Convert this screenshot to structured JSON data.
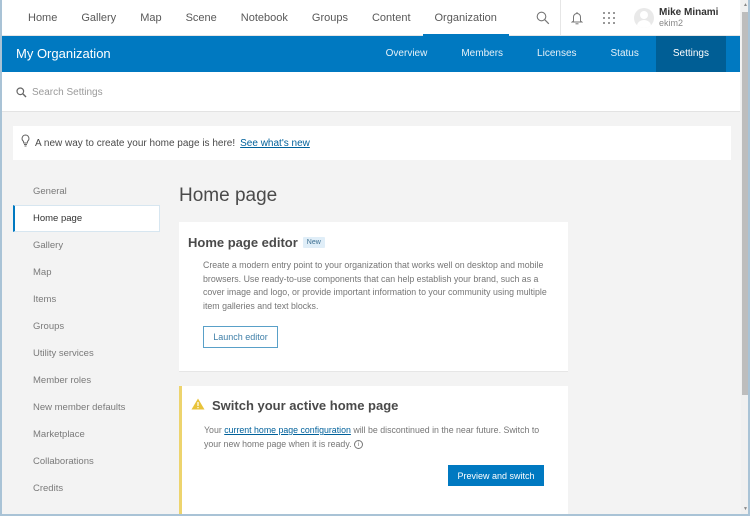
{
  "topnav": {
    "links": [
      {
        "label": "Home",
        "active": false
      },
      {
        "label": "Gallery",
        "active": false
      },
      {
        "label": "Map",
        "active": false
      },
      {
        "label": "Scene",
        "active": false
      },
      {
        "label": "Notebook",
        "active": false
      },
      {
        "label": "Groups",
        "active": false
      },
      {
        "label": "Content",
        "active": false
      },
      {
        "label": "Organization",
        "active": true
      }
    ],
    "icons": [
      "search-icon",
      "bell-icon",
      "apps-grid-icon"
    ],
    "user": {
      "full_name": "Mike Minami",
      "username": "ekim2"
    }
  },
  "orgbar": {
    "title": "My Organization",
    "tabs": [
      {
        "label": "Overview",
        "active": false
      },
      {
        "label": "Members",
        "active": false
      },
      {
        "label": "Licenses",
        "active": false
      },
      {
        "label": "Status",
        "active": false
      },
      {
        "label": "Settings",
        "active": true
      }
    ]
  },
  "search": {
    "placeholder": "Search Settings",
    "value": ""
  },
  "notice": {
    "icon": "lightbulb-icon",
    "text": "A new way to create your home page is here!",
    "link": "See what's new"
  },
  "sidebar": {
    "items": [
      {
        "label": "General",
        "active": false
      },
      {
        "label": "Home page",
        "active": true
      },
      {
        "label": "Gallery",
        "active": false
      },
      {
        "label": "Map",
        "active": false
      },
      {
        "label": "Items",
        "active": false
      },
      {
        "label": "Groups",
        "active": false
      },
      {
        "label": "Utility services",
        "active": false
      },
      {
        "label": "Member roles",
        "active": false
      },
      {
        "label": "New member defaults",
        "active": false
      },
      {
        "label": "Marketplace",
        "active": false
      },
      {
        "label": "Collaborations",
        "active": false
      },
      {
        "label": "Credits",
        "active": false
      }
    ]
  },
  "main": {
    "title": "Home page",
    "editor_card": {
      "heading": "Home page editor",
      "badge": "New",
      "description": "Create a modern entry point to your organization that works well on desktop and mobile browsers. Use ready-to-use components that can help establish your brand, such as a cover image and logo, or provide important information to your community using multiple item galleries and text blocks.",
      "button": "Launch editor"
    },
    "switch_card": {
      "heading": "Switch your active home page",
      "desc_prefix": "Your ",
      "desc_link": "current home page configuration",
      "desc_suffix": " will be discontinued in the near future. Switch to your new home page when it is ready. ",
      "info_glyph": "i",
      "button": "Preview and switch"
    }
  },
  "colors": {
    "brand_blue": "#0079c1",
    "active_tab": "#005e95",
    "warning_accent": "#edd46e",
    "link": "#00619b"
  }
}
